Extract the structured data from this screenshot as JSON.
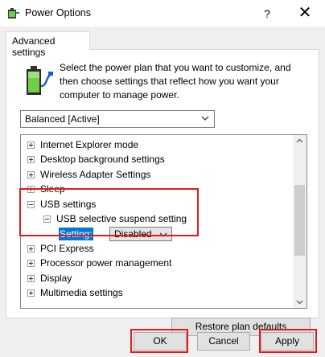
{
  "window": {
    "title": "Power Options",
    "help_glyph": "?",
    "close_glyph": "✕"
  },
  "tabs": [
    {
      "label": "Advanced settings",
      "selected": true
    }
  ],
  "description": "Select the power plan that you want to customize, and then choose settings that reflect how you want your computer to manage power.",
  "plan_select": {
    "value": "Balanced [Active]"
  },
  "tree_items": [
    {
      "label": "Internet Explorer mode",
      "expander": "+"
    },
    {
      "label": "Desktop background settings",
      "expander": "+"
    },
    {
      "label": "Wireless Adapter Settings",
      "expander": "+"
    },
    {
      "label": "Sleep",
      "expander": "+"
    },
    {
      "label": "USB settings",
      "expander": "-",
      "highlighted": true
    },
    {
      "label": "USB selective suspend setting",
      "expander": "-"
    },
    {
      "label": "PCI Express",
      "expander": "+"
    },
    {
      "label": "Processor power management",
      "expander": "+"
    },
    {
      "label": "Display",
      "expander": "+"
    },
    {
      "label": "Multimedia settings",
      "expander": "+"
    }
  ],
  "setting": {
    "label": "Setting:",
    "value": "Disabled"
  },
  "buttons": {
    "restore": "Restore plan defaults",
    "ok": "OK",
    "cancel": "Cancel",
    "apply": "Apply"
  },
  "colors": {
    "highlight_box": "#e21b1b",
    "selection": "#0078d7"
  },
  "icons": [
    "power-options-icon",
    "help-icon",
    "close-icon",
    "battery-plug-icon",
    "chevron-down-icon"
  ]
}
